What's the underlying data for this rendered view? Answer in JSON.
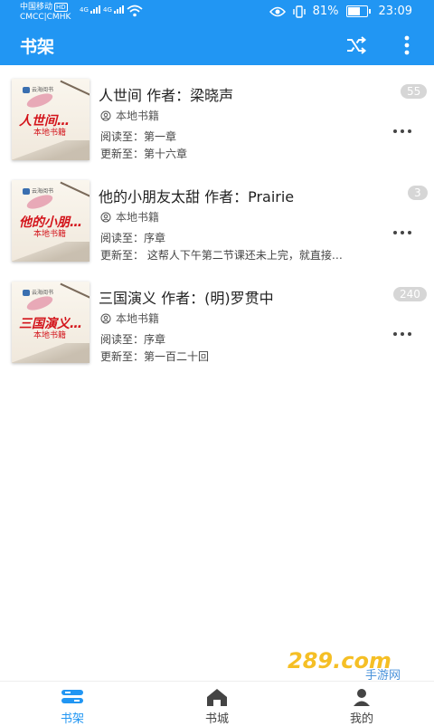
{
  "status_bar": {
    "carrier_line1": "中国移动",
    "carrier_hd": "HD",
    "carrier_line2": "CMCC|CMHK",
    "net1": "4G",
    "net2": "4G",
    "battery_text": "81%",
    "battery_level": 0.81,
    "time": "23:09"
  },
  "app_bar": {
    "title": "书架",
    "shuffle_icon": "shuffle-icon",
    "more_icon": "more-vertical-icon"
  },
  "books": [
    {
      "title": "人世间 作者：梁晓声",
      "source": "本地书籍",
      "read": "阅读至：第一章",
      "update": "更新至：第十六章",
      "badge": "55",
      "cover_title": "人世间…",
      "cover_sub": "本地书籍",
      "cover_brand": "云海阅书"
    },
    {
      "title": "他的小朋友太甜 作者：Prairie",
      "source": "本地书籍",
      "read": "阅读至：序章",
      "update": "更新至：       这帮人下午第二节课还未上完，就直接…",
      "badge": "3",
      "cover_title": "他的小朋…",
      "cover_sub": "本地书籍",
      "cover_brand": "云海阅书"
    },
    {
      "title": "三国演义 作者：(明)罗贯中",
      "source": "本地书籍",
      "read": "阅读至：序章",
      "update": "更新至：第一百二十回",
      "badge": "240",
      "cover_title": "三国演义…",
      "cover_sub": "本地书籍",
      "cover_brand": "云海阅书"
    }
  ],
  "bottom_nav": [
    {
      "label": "书架",
      "icon": "bookshelf-icon",
      "active": true
    },
    {
      "label": "书城",
      "icon": "home-icon",
      "active": false
    },
    {
      "label": "我的",
      "icon": "user-icon",
      "active": false
    }
  ],
  "watermark": {
    "text": "289.com",
    "sub": "手游网"
  },
  "colors": {
    "primary": "#2196F3",
    "cover_title": "#d3141b",
    "badge": "#d6d6d6"
  }
}
